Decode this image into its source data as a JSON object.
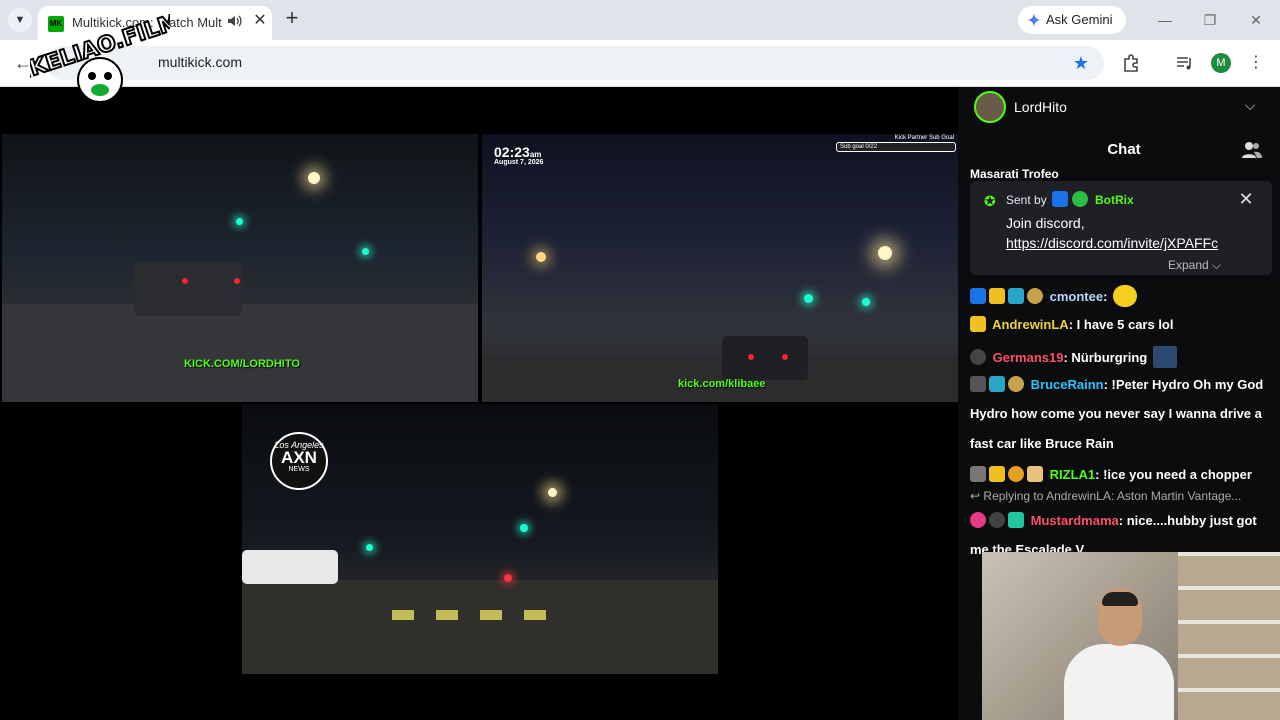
{
  "browser": {
    "tab": {
      "favicon_text": "MK",
      "title": "Multikick.com: Watch Multi"
    },
    "gemini_label": "Ask Gemini",
    "url": "multikick.com",
    "profile_initial": "M"
  },
  "overlay": {
    "logo_text": "MIKELIAO.FILMS"
  },
  "streams": [
    {
      "watermark": "KICK.COM/LORDHITO"
    },
    {
      "clock": "02:23",
      "clock_suffix": "am",
      "date": "August 7, 2026",
      "subgoal_title": "Kick Partner Sub Goal",
      "subgoal_text": "Sub goal 0/22",
      "watermark": "kick.com/klibaee"
    },
    {
      "logo_city": "Los Angeles",
      "logo_main": "AXN",
      "logo_sub": "NEWS"
    }
  ],
  "chat": {
    "channel": "LordHito",
    "title": "Chat",
    "cut_message": "Masarati Trofeo",
    "pinned": {
      "sent_by": "Sent by",
      "user": "BotRix",
      "text": "Join discord,",
      "link": "https://discord.com/invite/jXPAFFc",
      "expand": "Expand"
    },
    "messages": [
      {
        "user": "cmontee",
        "color": "#b6d7ff",
        "text": ""
      },
      {
        "user": "AndrewinLA",
        "color": "#f0d040",
        "text": "I have 5 cars lol"
      },
      {
        "user": "Germans19",
        "color": "#ff4f6a",
        "text": "Nürburgring"
      },
      {
        "user": "BruceRainn",
        "color": "#29c4ff",
        "text": "!Peter Hydro Oh my God",
        "cont1": "Hydro how come you never say I wanna drive a",
        "cont2": "fast car like Bruce Rain"
      },
      {
        "user": "RIZLA1",
        "color": "#53fc18",
        "text": "!ice you need a chopper",
        "reply_prefix": "Replying to",
        "reply_user": "AndrewinLA",
        "reply_text": "Aston Martin Vantage..."
      },
      {
        "user": "Mustardmama",
        "color": "#ff4f6a",
        "text": "nice....hubby just got",
        "cont1": "me the Escalade V"
      }
    ]
  },
  "colors": {
    "kick_green": "#53fc18",
    "chat_bg": "#0b0c0e",
    "star_blue": "#1a73e8"
  }
}
